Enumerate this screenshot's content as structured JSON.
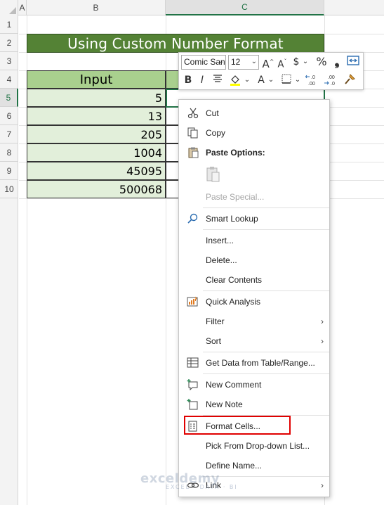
{
  "sheet": {
    "columns": [
      "A",
      "B",
      "C"
    ],
    "rows": [
      "1",
      "2",
      "3",
      "4",
      "5",
      "6",
      "7",
      "8",
      "9",
      "10"
    ],
    "title": "Using Custom Number Format",
    "input_header": "Input",
    "inputs": [
      "5",
      "13",
      "205",
      "1004",
      "45095",
      "500068"
    ]
  },
  "mini_toolbar": {
    "font": "Comic Sans MS",
    "size": "12",
    "grow_font": "A",
    "shrink_font": "A",
    "currency": "$",
    "percent": "%",
    "comma": "❟",
    "bold": "B",
    "italic": "I",
    "font_color": "A"
  },
  "context_menu": {
    "cut": "Cut",
    "copy": "Copy",
    "paste_options": "Paste Options:",
    "paste_special": "Paste Special...",
    "smart_lookup": "Smart Lookup",
    "insert": "Insert...",
    "delete": "Delete...",
    "clear_contents": "Clear Contents",
    "quick_analysis": "Quick Analysis",
    "filter": "Filter",
    "sort": "Sort",
    "get_data": "Get Data from Table/Range...",
    "new_comment": "New Comment",
    "new_note": "New Note",
    "format_cells": "Format Cells...",
    "pick_from_list": "Pick From Drop-down List...",
    "define_name": "Define Name...",
    "link": "Link"
  },
  "watermark": {
    "name": "exceldemy",
    "tagline": "EXCEL · DATA · BI"
  },
  "colors": {
    "title_bg": "#548235",
    "header_bg": "#a9d08e",
    "data_bg": "#e2efda",
    "highlight": "#e00000"
  }
}
